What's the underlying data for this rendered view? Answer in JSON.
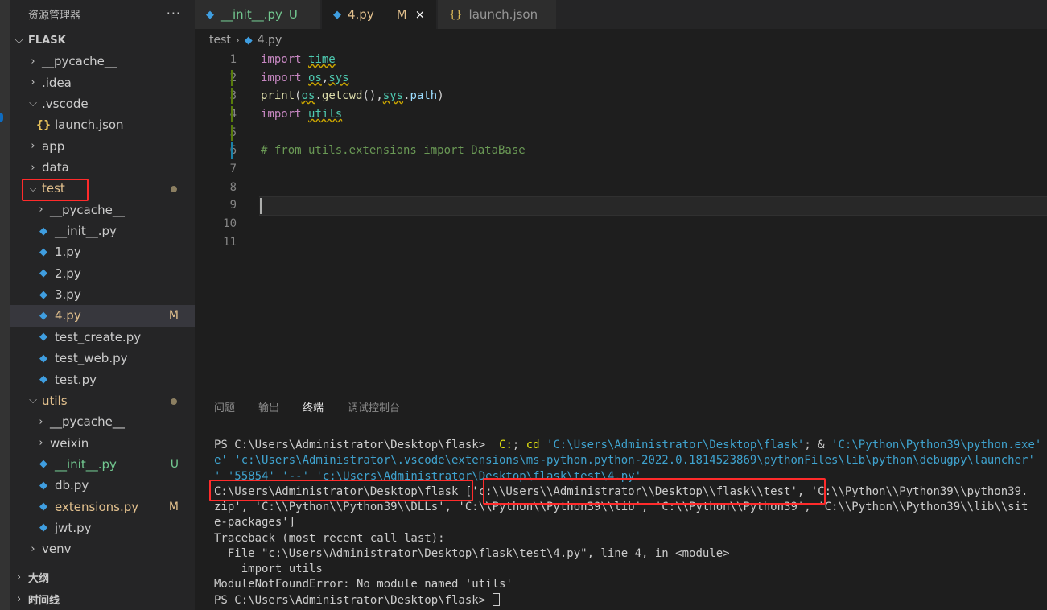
{
  "sidebar": {
    "title": "资源管理器",
    "more": "···",
    "workspace": "FLASK",
    "outline": "大纲",
    "timeline": "时间线",
    "tree": [
      {
        "label": "__pycache__",
        "kind": "folder",
        "expanded": false,
        "depth": 1
      },
      {
        "label": ".idea",
        "kind": "folder",
        "expanded": false,
        "depth": 1
      },
      {
        "label": ".vscode",
        "kind": "folder",
        "expanded": true,
        "depth": 1
      },
      {
        "label": "launch.json",
        "kind": "json",
        "depth": 2
      },
      {
        "label": "app",
        "kind": "folder",
        "expanded": false,
        "depth": 1
      },
      {
        "label": "data",
        "kind": "folder",
        "expanded": false,
        "depth": 1
      },
      {
        "label": "test",
        "kind": "folder",
        "expanded": true,
        "depth": 1,
        "dot": true,
        "color": "modified",
        "highlight": true
      },
      {
        "label": "__pycache__",
        "kind": "folder",
        "expanded": false,
        "depth": 2
      },
      {
        "label": "__init__.py",
        "kind": "py",
        "depth": 2
      },
      {
        "label": "1.py",
        "kind": "py",
        "depth": 2
      },
      {
        "label": "2.py",
        "kind": "py",
        "depth": 2
      },
      {
        "label": "3.py",
        "kind": "py",
        "depth": 2
      },
      {
        "label": "4.py",
        "kind": "py",
        "depth": 2,
        "status": "M",
        "color": "modified",
        "active": true
      },
      {
        "label": "test_create.py",
        "kind": "py",
        "depth": 2
      },
      {
        "label": "test_web.py",
        "kind": "py",
        "depth": 2
      },
      {
        "label": "test.py",
        "kind": "py",
        "depth": 2
      },
      {
        "label": "utils",
        "kind": "folder",
        "expanded": true,
        "depth": 1,
        "dot": true,
        "color": "modified"
      },
      {
        "label": "__pycache__",
        "kind": "folder",
        "expanded": false,
        "depth": 2
      },
      {
        "label": "weixin",
        "kind": "folder",
        "expanded": false,
        "depth": 2
      },
      {
        "label": "__init__.py",
        "kind": "py",
        "depth": 2,
        "status": "U",
        "color": "untracked"
      },
      {
        "label": "db.py",
        "kind": "py",
        "depth": 2
      },
      {
        "label": "extensions.py",
        "kind": "py",
        "depth": 2,
        "status": "M",
        "color": "modified"
      },
      {
        "label": "jwt.py",
        "kind": "py",
        "depth": 2
      },
      {
        "label": "venv",
        "kind": "folder",
        "expanded": false,
        "depth": 1
      }
    ]
  },
  "tabs": [
    {
      "label": "__init__.py",
      "status": "U",
      "color": "untracked",
      "icon": "python-file-icon"
    },
    {
      "label": "4.py",
      "status": "M",
      "color": "modified",
      "icon": "python-file-icon",
      "active": true,
      "close": "×"
    },
    {
      "label": "launch.json",
      "icon": "json-file-icon"
    }
  ],
  "breadcrumb": {
    "folder": "test",
    "file": "4.py"
  },
  "editor": {
    "line_numbers": [
      "1",
      "2",
      "3",
      "4",
      "5",
      "6",
      "7",
      "8",
      "9",
      "10",
      "11"
    ],
    "lines": [
      {
        "gutter": "",
        "tokens": [
          {
            "t": "import",
            "c": "kw"
          },
          {
            "t": " ",
            "c": "pl"
          },
          {
            "t": "time",
            "c": "mod"
          }
        ]
      },
      {
        "gutter": "added",
        "tokens": [
          {
            "t": "import",
            "c": "kw"
          },
          {
            "t": " ",
            "c": "pl"
          },
          {
            "t": "os",
            "c": "mod"
          },
          {
            "t": ",",
            "c": "pl"
          },
          {
            "t": "sys",
            "c": "mod"
          }
        ]
      },
      {
        "gutter": "added",
        "tokens": [
          {
            "t": "print",
            "c": "fn"
          },
          {
            "t": "(",
            "c": "pl"
          },
          {
            "t": "os",
            "c": "mod"
          },
          {
            "t": ".",
            "c": "pl"
          },
          {
            "t": "getcwd",
            "c": "fn"
          },
          {
            "t": "(),",
            "c": "pl"
          },
          {
            "t": "sys",
            "c": "mod"
          },
          {
            "t": ".",
            "c": "pl"
          },
          {
            "t": "path",
            "c": "var"
          },
          {
            "t": ")",
            "c": "pl"
          }
        ]
      },
      {
        "gutter": "added",
        "tokens": [
          {
            "t": "import",
            "c": "kw"
          },
          {
            "t": " ",
            "c": "pl"
          },
          {
            "t": "utils",
            "c": "mod"
          }
        ]
      },
      {
        "gutter": "added",
        "tokens": []
      },
      {
        "gutter": "modified",
        "tokens": [
          {
            "t": "# from utils.extensions import DataBase",
            "c": "cmt"
          }
        ]
      },
      {
        "gutter": "",
        "tokens": []
      },
      {
        "gutter": "",
        "tokens": []
      },
      {
        "gutter": "",
        "tokens": []
      },
      {
        "gutter": "",
        "tokens": []
      },
      {
        "gutter": "",
        "tokens": []
      }
    ]
  },
  "panel": {
    "tabs": [
      {
        "label": "问题"
      },
      {
        "label": "输出"
      },
      {
        "label": "终端",
        "active": true
      },
      {
        "label": "调试控制台"
      }
    ],
    "terminal": [
      [
        {
          "t": "PS C:\\Users\\Administrator\\Desktop\\flask>  "
        },
        {
          "t": "C:",
          "c": "t-cmd"
        },
        {
          "t": "; "
        },
        {
          "t": "cd",
          "c": "t-cmd"
        },
        {
          "t": " "
        },
        {
          "t": "'C:\\Users\\Administrator\\Desktop\\flask'",
          "c": "t-str"
        },
        {
          "t": "; & "
        },
        {
          "t": "'C:\\Python\\Python39\\python.exe'",
          "c": "t-str"
        }
      ],
      [
        {
          "t": "e' 'c:\\Users\\Administrator\\.vscode\\extensions\\ms-python.python-2022.0.1814523869\\pythonFiles\\lib\\python\\debugpy\\launcher'",
          "c": "t-str"
        }
      ],
      [
        {
          "t": "' '55854' '--' 'c:\\Users\\Administrator\\Desktop\\flask\\test\\4.py'",
          "c": "t-str"
        }
      ],
      [
        {
          "t": "C:\\Users\\Administrator\\Desktop\\flask ['c:\\\\Users\\\\Administrator\\\\Desktop\\\\flask\\\\test', 'C:\\\\Python\\\\Python39\\\\python39."
        }
      ],
      [
        {
          "t": "zip', 'C:\\\\Python\\\\Python39\\\\DLLs', 'C:\\\\Python\\\\Python39\\\\lib', 'C:\\\\Python\\\\Python39', 'C:\\\\Python\\\\Python39\\\\lib\\\\sit"
        }
      ],
      [
        {
          "t": "e-packages']"
        }
      ],
      [
        {
          "t": "Traceback (most recent call last):"
        }
      ],
      [
        {
          "t": "  File \"c:\\Users\\Administrator\\Desktop\\flask\\test\\4.py\", line 4, in <module>"
        }
      ],
      [
        {
          "t": "    import utils"
        }
      ],
      [
        {
          "t": "ModuleNotFoundError: No module named 'utils'"
        }
      ],
      [
        {
          "t": "PS C:\\Users\\Administrator\\Desktop\\flask> "
        }
      ]
    ]
  },
  "colors": {
    "accent_box": "#ff2b2b",
    "modified": "#e2c08d",
    "untracked": "#73c991",
    "python_icon": "#3f9ee0",
    "json_icon": "#e8c35a"
  }
}
